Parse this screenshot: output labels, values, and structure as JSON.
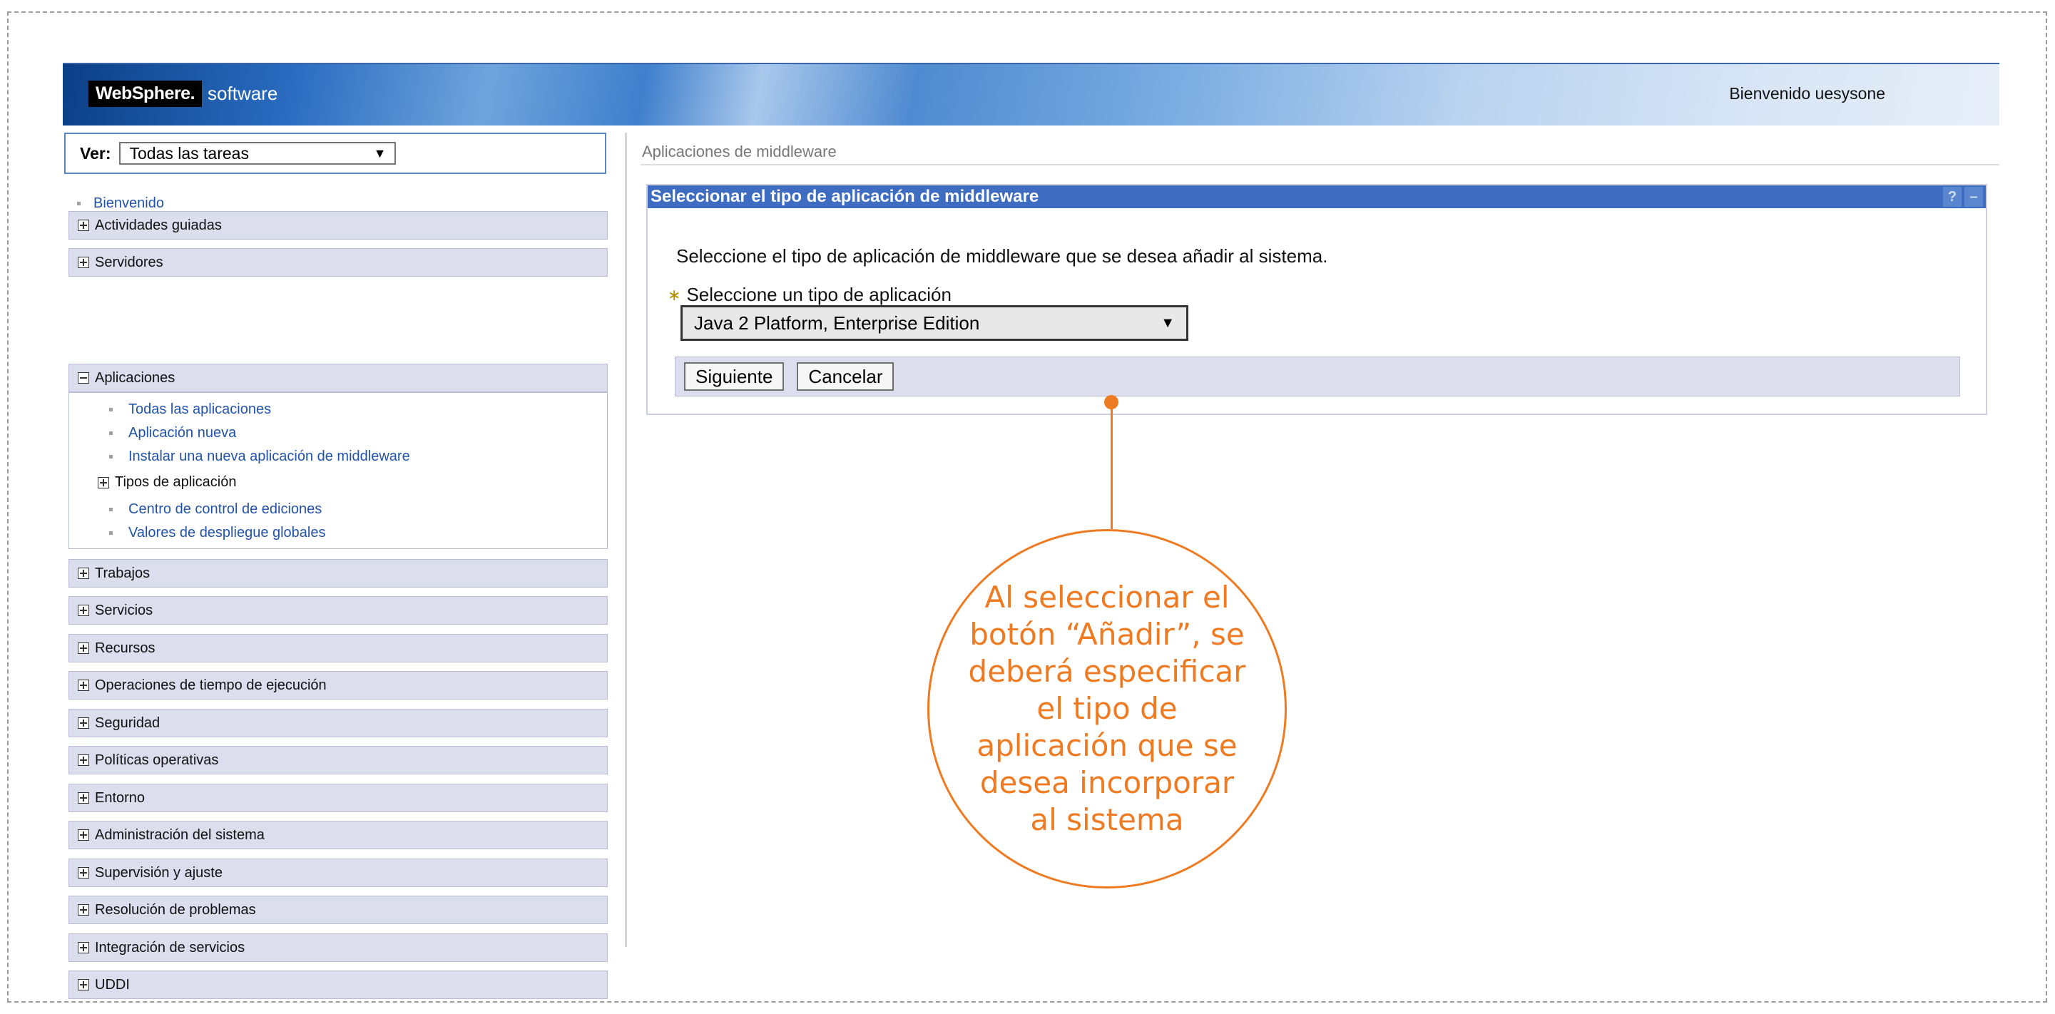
{
  "header": {
    "brand": "WebSphere.",
    "brand_suffix": "software",
    "welcome": "Bienvenido uesysone"
  },
  "sidebar": {
    "view_label": "Ver:",
    "view_value": "Todas las tareas",
    "welcome_link": "Bienvenido",
    "sections": [
      {
        "label": "Actividades guiadas",
        "expanded": false
      },
      {
        "label": "Servidores",
        "expanded": false
      },
      {
        "label": "Aplicaciones",
        "expanded": true
      },
      {
        "label": "Trabajos",
        "expanded": false
      },
      {
        "label": "Servicios",
        "expanded": false
      },
      {
        "label": "Recursos",
        "expanded": false
      },
      {
        "label": "Operaciones de tiempo de ejecución",
        "expanded": false
      },
      {
        "label": "Seguridad",
        "expanded": false
      },
      {
        "label": "Políticas operativas",
        "expanded": false
      },
      {
        "label": "Entorno",
        "expanded": false
      },
      {
        "label": "Administración del sistema",
        "expanded": false
      },
      {
        "label": "Supervisión y ajuste",
        "expanded": false
      },
      {
        "label": "Resolución de problemas",
        "expanded": false
      },
      {
        "label": "Integración de servicios",
        "expanded": false
      },
      {
        "label": "UDDI",
        "expanded": false
      }
    ],
    "applications_children": [
      "Todas las aplicaciones",
      "Aplicación nueva",
      "Instalar una nueva aplicación de middleware",
      "Tipos de aplicación",
      "Centro de control de ediciones",
      "Valores de despliegue globales"
    ]
  },
  "main": {
    "breadcrumb": "Aplicaciones de middleware",
    "panel_title": "Seleccionar el tipo de aplicación de middleware",
    "help_label": "?",
    "minimize_label": "–",
    "description": "Seleccione el tipo de aplicación de middleware que se desea añadir al sistema.",
    "field_label": "Seleccione un tipo de aplicación",
    "required_mark": "∗",
    "selected_type": "Java 2 Platform, Enterprise Edition",
    "next_button": "Siguiente",
    "cancel_button": "Cancelar"
  },
  "callout": {
    "text": "Al seleccionar el botón “Añadir”, se deberá especificar el tipo de aplicación que se desea incorporar al sistema",
    "color": "#ee7a22"
  },
  "colors": {
    "header_blue": "#3e6cc0",
    "nav_bg": "#dcdeee",
    "link": "#2253a8"
  },
  "icons": {
    "expand": "plus-box-icon",
    "collapse": "minus-box-icon",
    "dropdown": "triangle-down-icon"
  }
}
